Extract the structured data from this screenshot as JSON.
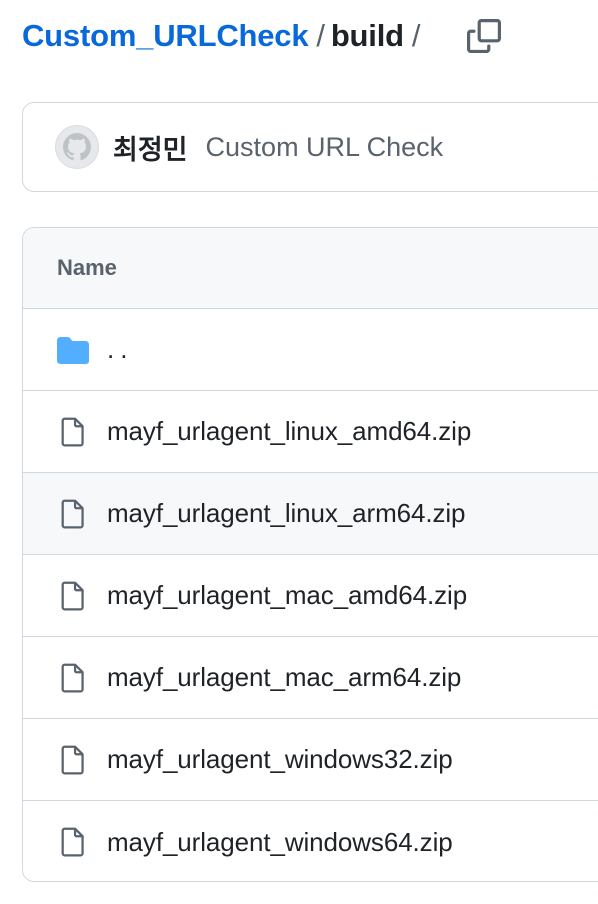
{
  "breadcrumb": {
    "repo": "Custom_URLCheck",
    "separator": "/",
    "current": "build",
    "trailing_separator": "/"
  },
  "copy_button": {
    "icon": "copy-icon"
  },
  "latest_commit": {
    "avatar_icon": "github-mark-icon",
    "author": "최정민",
    "message": "Custom URL Check"
  },
  "file_table": {
    "header": "Name",
    "parent_dir": {
      "label": "..",
      "icon": "folder-icon",
      "icon_color": "#54aeff"
    },
    "files": [
      {
        "name": "mayf_urlagent_linux_amd64.zip",
        "icon": "file-icon"
      },
      {
        "name": "mayf_urlagent_linux_arm64.zip",
        "icon": "file-icon"
      },
      {
        "name": "mayf_urlagent_mac_amd64.zip",
        "icon": "file-icon"
      },
      {
        "name": "mayf_urlagent_mac_arm64.zip",
        "icon": "file-icon"
      },
      {
        "name": "mayf_urlagent_windows32.zip",
        "icon": "file-icon"
      },
      {
        "name": "mayf_urlagent_windows64.zip",
        "icon": "file-icon"
      }
    ]
  },
  "colors": {
    "link": "#0969da",
    "muted": "#59636e",
    "border": "#d1d9e0",
    "header_bg": "#f6f8fa"
  }
}
